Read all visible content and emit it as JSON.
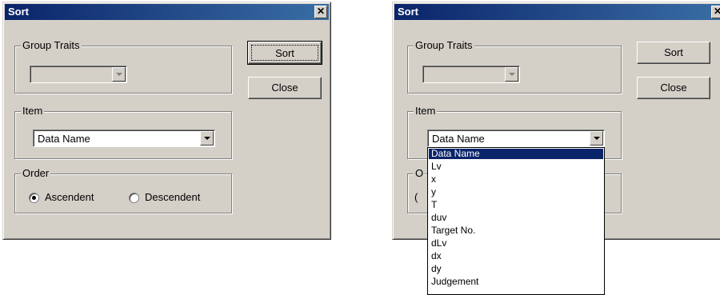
{
  "dialogs": [
    {
      "title": "Sort",
      "close_glyph": "✕",
      "group_traits": {
        "label": "Group Traits",
        "value": ""
      },
      "item": {
        "label": "Item",
        "value": "Data Name"
      },
      "order": {
        "label": "Order",
        "options": [
          "Ascendent",
          "Descendent"
        ],
        "selected": "Ascendent"
      },
      "buttons": {
        "sort": "Sort",
        "close": "Close"
      }
    },
    {
      "title": "Sort",
      "close_glyph": "✕",
      "group_traits": {
        "label": "Group Traits",
        "value": ""
      },
      "item": {
        "label": "Item",
        "value": "Data Name",
        "dropdown_open": true
      },
      "order": {
        "label": "O",
        "partial_radio": "("
      },
      "buttons": {
        "sort": "Sort",
        "close": "Close"
      }
    }
  ],
  "item_dropdown_options": [
    "Data Name",
    "Lv",
    "x",
    "y",
    "T",
    "duv",
    "Target No.",
    "dLv",
    "dx",
    "dy",
    "Judgement"
  ],
  "item_dropdown_selected": "Data Name",
  "colors": {
    "titlebar_start": "#0a246a",
    "titlebar_end": "#3a6ea5",
    "face": "#d4d0c8",
    "highlight": "#0a246a"
  }
}
